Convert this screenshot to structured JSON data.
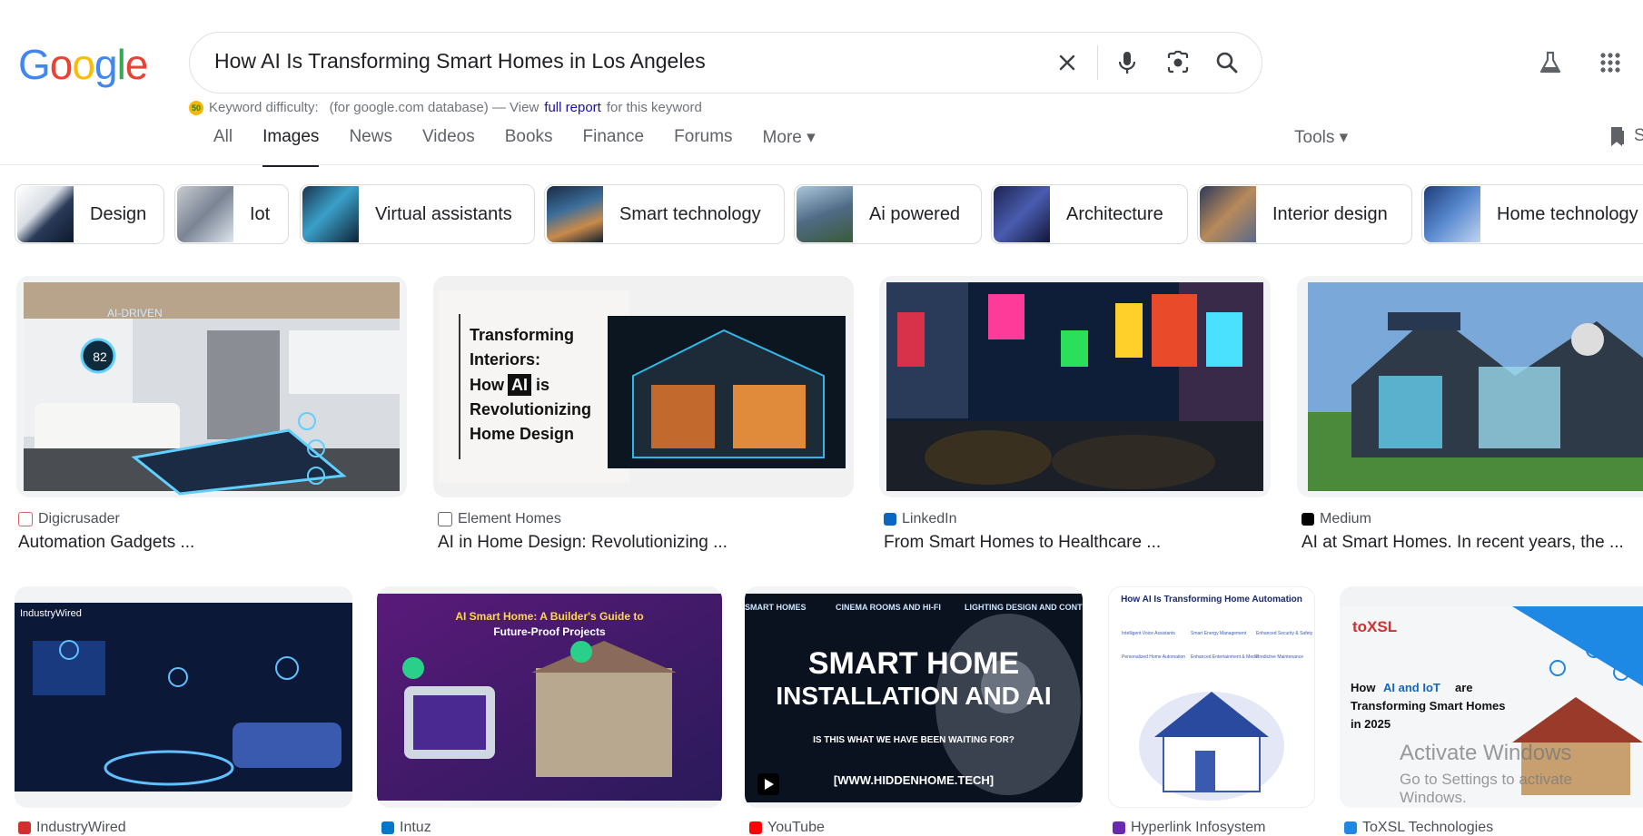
{
  "search": {
    "query": "How AI Is Transforming Smart Homes in Los Angeles"
  },
  "logo": {
    "letters": [
      "G",
      "o",
      "o",
      "g",
      "l",
      "e"
    ],
    "colors": [
      "#4285F4",
      "#EA4335",
      "#FBBC05",
      "#4285F4",
      "#34A853",
      "#EA4335"
    ]
  },
  "keyword": {
    "badge": "50",
    "prefix": "Keyword difficulty:",
    "middle": "(for google.com database) — View",
    "link": "full report",
    "suffix": "for this keyword"
  },
  "tabs": [
    {
      "label": "All"
    },
    {
      "label": "Images"
    },
    {
      "label": "News"
    },
    {
      "label": "Videos"
    },
    {
      "label": "Books"
    },
    {
      "label": "Finance"
    },
    {
      "label": "Forums"
    },
    {
      "label": "More ▾"
    }
  ],
  "tools": {
    "label": "Tools ▾",
    "saved_label": "S"
  },
  "chips": [
    {
      "label": "Design"
    },
    {
      "label": "Iot"
    },
    {
      "label": "Virtual assistants"
    },
    {
      "label": "Smart technology"
    },
    {
      "label": "Ai powered"
    },
    {
      "label": "Architecture"
    },
    {
      "label": "Interior design"
    },
    {
      "label": "Home technology"
    }
  ],
  "results_row1": [
    {
      "source": "Digicrusader",
      "title": "Automation Gadgets ...",
      "icon": "digicrusader-favicon"
    },
    {
      "source": "Element Homes",
      "title": "AI in Home Design: Revolutionizing ...",
      "icon": "element-homes-favicon"
    },
    {
      "source": "LinkedIn",
      "title": "From Smart Homes to Healthcare ...",
      "icon": "linkedin-favicon"
    },
    {
      "source": "Medium",
      "title": "AI at Smart Homes. In recent years, the ...",
      "icon": "medium-favicon"
    }
  ],
  "results_row2": [
    {
      "source": "IndustryWired",
      "icon": "industrywired-favicon"
    },
    {
      "source": "Intuz",
      "icon": "intuz-favicon"
    },
    {
      "source": "YouTube",
      "icon": "youtube-favicon"
    },
    {
      "source": "Hyperlink Infosystem",
      "icon": "hyperlink-favicon"
    },
    {
      "source": "ToXSL Technologies",
      "icon": "toxsl-favicon"
    }
  ],
  "image_text": {
    "ai_driven": "AI-DRIVEN",
    "temp": "82",
    "element_lines": [
      "Transforming",
      "Interiors:",
      "How",
      "AI",
      "is",
      "Revolutionizing",
      "Home Design"
    ],
    "industrywired": "IndustryWired",
    "intuz_title": "AI Smart Home: A Builder's Guide to",
    "intuz_sub": "Future-Proof Projects",
    "yt_top": [
      "SMART HOMES",
      "CINEMA ROOMS AND HI-FI",
      "LIGHTING DESIGN AND CONTRO"
    ],
    "yt_big1": "SMART HOME",
    "yt_big2": "INSTALLATION AND AI",
    "yt_q": "IS THIS WHAT WE HAVE BEEN WAITING FOR?",
    "yt_url": "[WWW.HIDDENHOME.TECH]",
    "hl_title": "How AI Is Transforming Home Automation",
    "hl_items": [
      "Intelligent Voice Assistants",
      "Smart Energy Management",
      "Enhanced Security & Safety",
      "Personalized Home Automation",
      "Enhanced Entertainment & Media",
      "Predictive Maintenance"
    ],
    "toxsl_logo": "toXSL",
    "toxsl_l1a": "How",
    "toxsl_l1b": "AI and IoT",
    "toxsl_l1c": "are",
    "toxsl_l2": "Transforming Smart Homes",
    "toxsl_l3": "in 2025"
  },
  "watermark": {
    "line1": "Activate Windows",
    "line2": "Go to Settings to activate Windows."
  }
}
